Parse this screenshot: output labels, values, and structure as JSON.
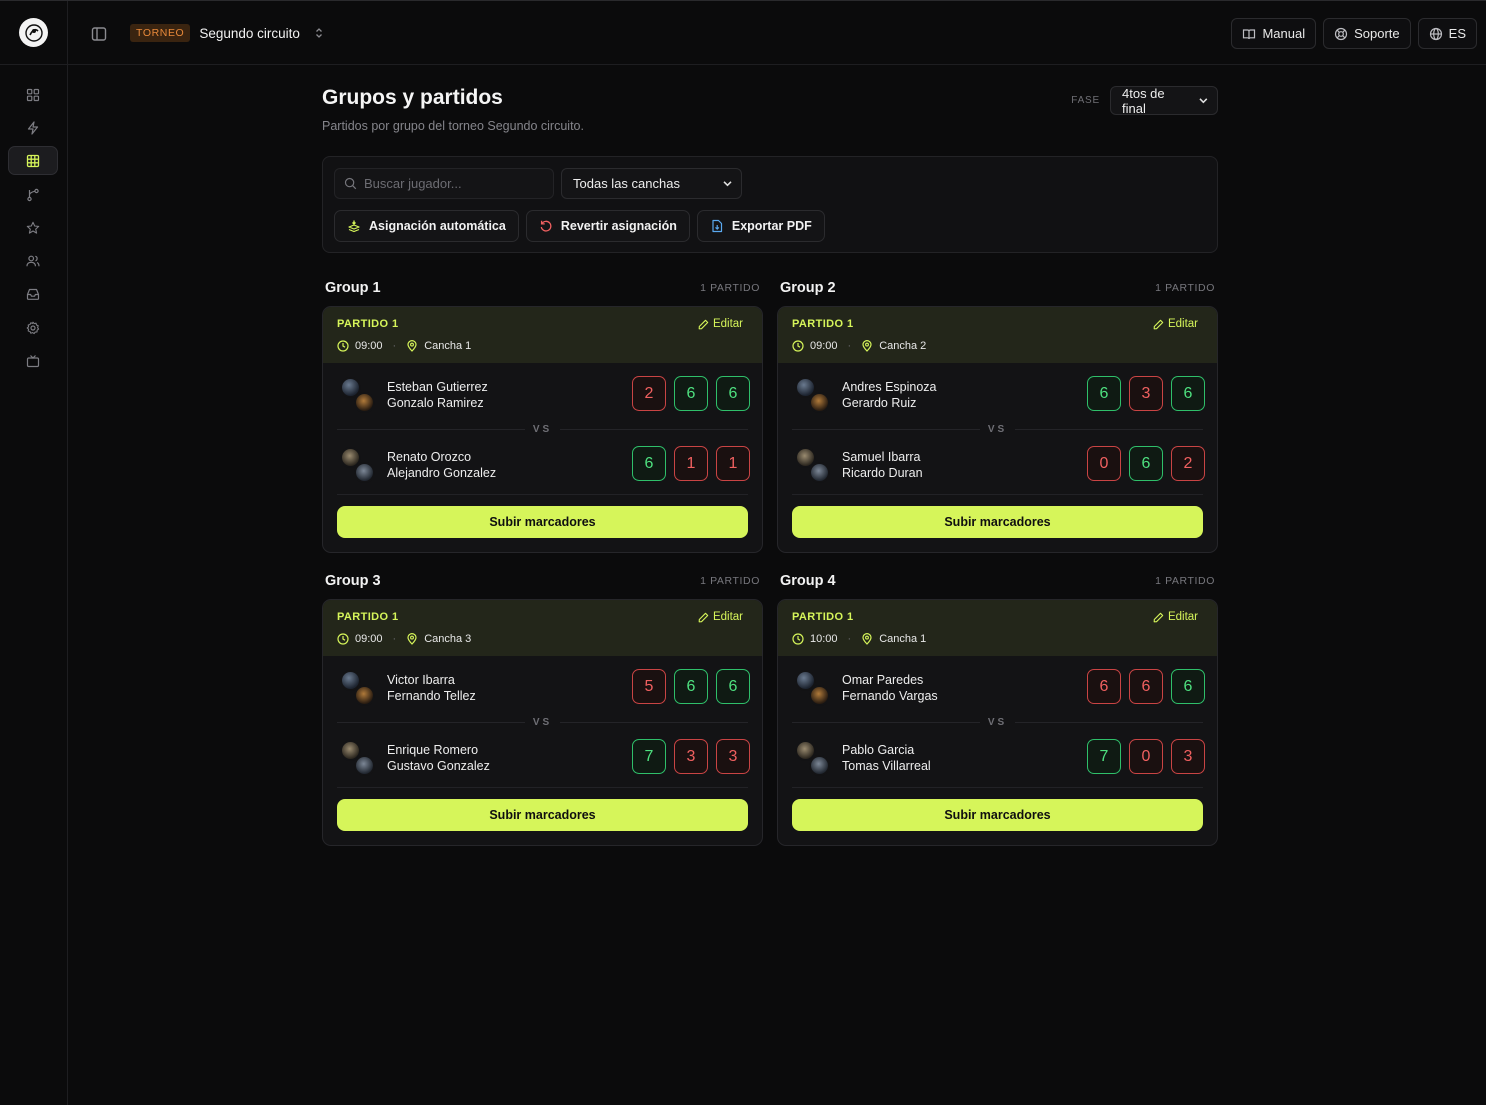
{
  "header": {
    "tournament_badge": "TORNEO",
    "tournament_name": "Segundo circuito",
    "manual_label": "Manual",
    "support_label": "Soporte",
    "language_label": "ES"
  },
  "page": {
    "title": "Grupos y partidos",
    "subtitle": "Partidos por grupo del torneo Segundo circuito.",
    "phase_label": "FASE",
    "phase_value": "4tos de final"
  },
  "filters": {
    "search_placeholder": "Buscar jugador...",
    "court_select": "Todas las canchas",
    "auto_assign_label": "Asignación automática",
    "revert_label": "Revertir asignación",
    "export_label": "Exportar PDF"
  },
  "vs_label": "VS",
  "edit_label": "Editar",
  "submit_label": "Subir marcadores",
  "groups": [
    {
      "name": "Group 1",
      "count": "1 PARTIDO",
      "match": "PARTIDO 1",
      "time": "09:00",
      "court": "Cancha 1",
      "team1": {
        "player1": "Esteban Gutierrez",
        "player2": "Gonzalo Ramirez",
        "scores": [
          "2",
          "6",
          "6"
        ],
        "results": [
          "lose",
          "win",
          "win"
        ]
      },
      "team2": {
        "player1": "Renato Orozco",
        "player2": "Alejandro Gonzalez",
        "scores": [
          "6",
          "1",
          "1"
        ],
        "results": [
          "win",
          "lose",
          "lose"
        ]
      }
    },
    {
      "name": "Group 2",
      "count": "1 PARTIDO",
      "match": "PARTIDO 1",
      "time": "09:00",
      "court": "Cancha 2",
      "team1": {
        "player1": "Andres Espinoza",
        "player2": "Gerardo Ruiz",
        "scores": [
          "6",
          "3",
          "6"
        ],
        "results": [
          "win",
          "lose",
          "win"
        ]
      },
      "team2": {
        "player1": "Samuel Ibarra",
        "player2": "Ricardo Duran",
        "scores": [
          "0",
          "6",
          "2"
        ],
        "results": [
          "lose",
          "win",
          "lose"
        ]
      }
    },
    {
      "name": "Group 3",
      "count": "1 PARTIDO",
      "match": "PARTIDO 1",
      "time": "09:00",
      "court": "Cancha 3",
      "team1": {
        "player1": "Victor Ibarra",
        "player2": "Fernando Tellez",
        "scores": [
          "5",
          "6",
          "6"
        ],
        "results": [
          "lose",
          "win",
          "win"
        ]
      },
      "team2": {
        "player1": "Enrique Romero",
        "player2": "Gustavo Gonzalez",
        "scores": [
          "7",
          "3",
          "3"
        ],
        "results": [
          "win",
          "lose",
          "lose"
        ]
      }
    },
    {
      "name": "Group 4",
      "count": "1 PARTIDO",
      "match": "PARTIDO 1",
      "time": "10:00",
      "court": "Cancha 1",
      "team1": {
        "player1": "Omar Paredes",
        "player2": "Fernando Vargas",
        "scores": [
          "6",
          "6",
          "6"
        ],
        "results": [
          "lose",
          "lose",
          "win"
        ]
      },
      "team2": {
        "player1": "Pablo Garcia",
        "player2": "Tomas Villarreal",
        "scores": [
          "7",
          "0",
          "3"
        ],
        "results": [
          "win",
          "lose",
          "lose"
        ]
      }
    }
  ],
  "colors": {
    "accent": "#d6f55a",
    "win": "#4ee07f",
    "lose": "#f06060",
    "badge": "#e8893a"
  },
  "sidebar_icons": [
    "grid-icon",
    "bolt-icon",
    "table-icon",
    "bracket-icon",
    "star-icon",
    "users-icon",
    "inbox-icon",
    "settings-icon",
    "tv-icon"
  ]
}
